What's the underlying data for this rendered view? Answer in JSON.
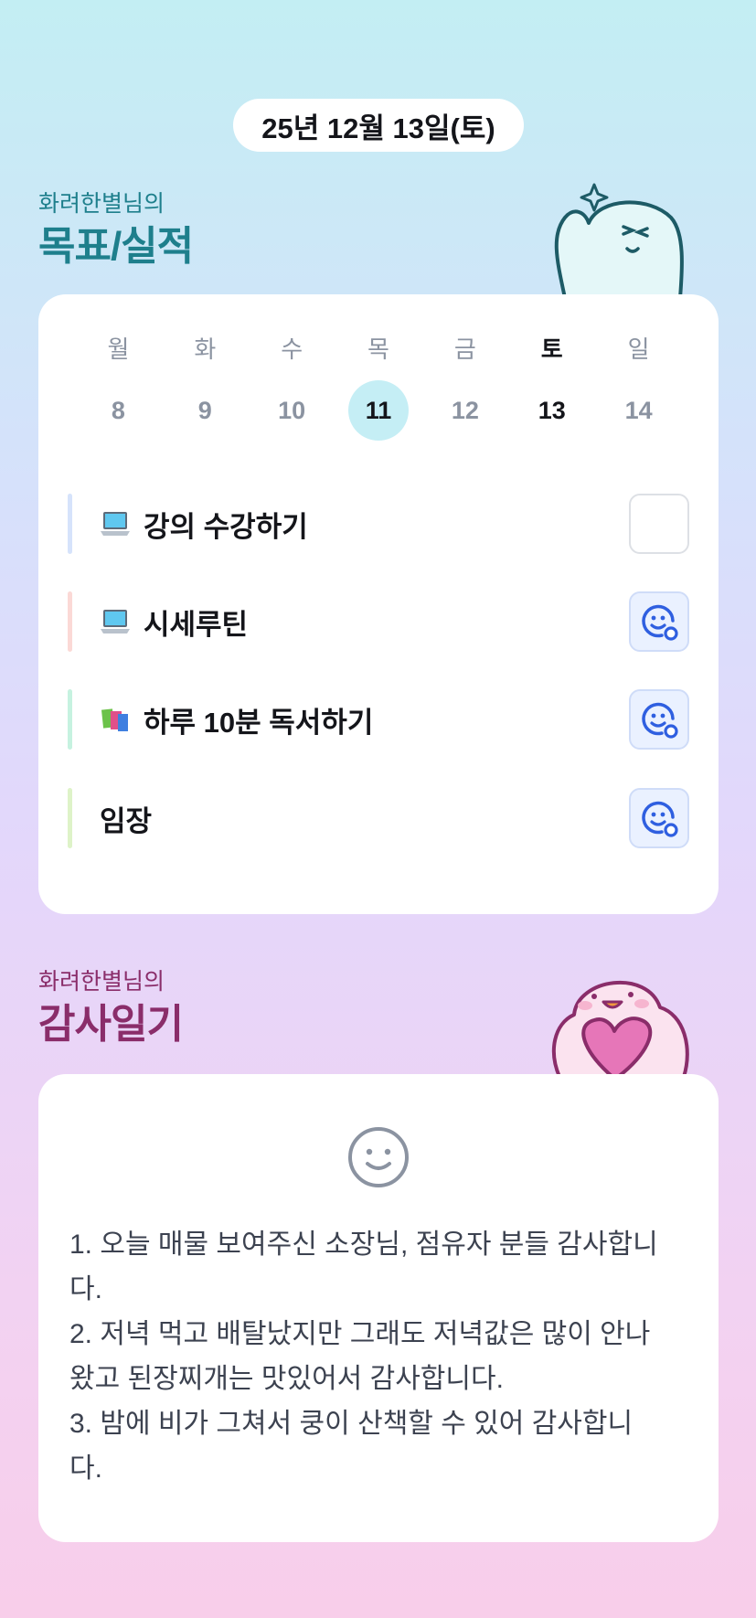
{
  "date_label": "25년 12월 13일(토)",
  "goals_section": {
    "subtitle": "화려한별님의",
    "title": "목표/실적",
    "accent": "#1e7f8c"
  },
  "calendar": {
    "days": [
      {
        "name": "월",
        "num": "8"
      },
      {
        "name": "화",
        "num": "9"
      },
      {
        "name": "수",
        "num": "10"
      },
      {
        "name": "목",
        "num": "11"
      },
      {
        "name": "금",
        "num": "12"
      },
      {
        "name": "토",
        "num": "13"
      },
      {
        "name": "일",
        "num": "14"
      }
    ],
    "selected": "11",
    "today": "13"
  },
  "goals": [
    {
      "emoji": "laptop-icon",
      "label": "강의 수강하기",
      "bar_color": "#d6e3fb",
      "status": "empty"
    },
    {
      "emoji": "laptop-icon",
      "label": "시세루틴",
      "bar_color": "#fbd9d6",
      "status": "done"
    },
    {
      "emoji": "books-icon",
      "label": "하루 10분 독서하기",
      "bar_color": "#c6f2e0",
      "status": "done"
    },
    {
      "emoji": "",
      "label": "임장",
      "bar_color": "#def3c8",
      "status": "done"
    }
  ],
  "diary_section": {
    "subtitle": "화려한별님의",
    "title": "감사일기",
    "accent": "#8a2d6a"
  },
  "diary": {
    "mood_icon": "smile-face-icon",
    "lines": [
      "1. 오늘 매물 보여주신 소장님, 점유자 분들 감사합니",
      "다.",
      "2. 저녁 먹고 배탈났지만 그래도 저녁값은 많이 안나",
      "왔고 된장찌개는 맛있어서 감사합니다.",
      "3. 밤에 비가 그쳐서 쿵이 산책할 수 있어 감사합니",
      "다."
    ]
  }
}
